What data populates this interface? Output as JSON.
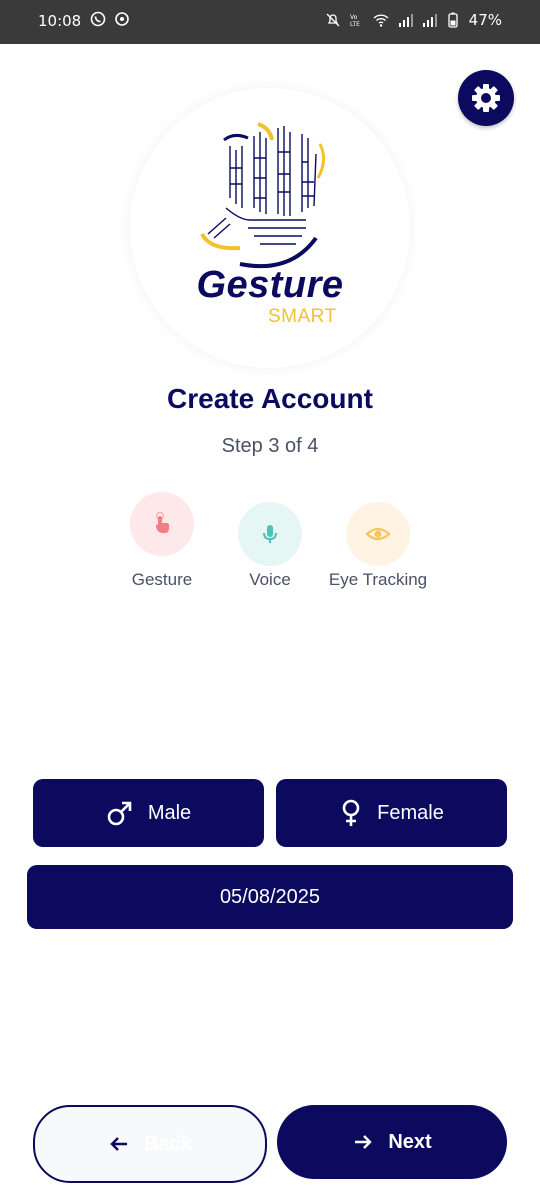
{
  "status_bar": {
    "time": "10:08",
    "battery": "47%",
    "icons": [
      "whatsapp-icon",
      "settings-app-icon",
      "mute-icon",
      "volte-icon",
      "wifi-icon",
      "signal-icon",
      "signal-icon",
      "battery-icon"
    ]
  },
  "logo": {
    "primary": "Gesture",
    "secondary": "SMART"
  },
  "header": {
    "title": "Create Account",
    "step": "Step 3 of 4"
  },
  "modes": [
    {
      "label": "Gesture",
      "icon": "touch-icon",
      "bg": "#fde8ea",
      "color": "#f27d83"
    },
    {
      "label": "Voice",
      "icon": "microphone-icon",
      "bg": "#e6f6f5",
      "color": "#49c2b7"
    },
    {
      "label": "Eye Tracking",
      "icon": "eye-icon",
      "bg": "#fff4e3",
      "color": "#f5c45e"
    }
  ],
  "gender": {
    "male_label": "Male",
    "female_label": "Female"
  },
  "date": {
    "value": "05/08/2025"
  },
  "nav": {
    "back_label": "Back",
    "next_label": "Next"
  },
  "colors": {
    "primary": "#0b0a5e",
    "accent": "#f2c12e"
  }
}
